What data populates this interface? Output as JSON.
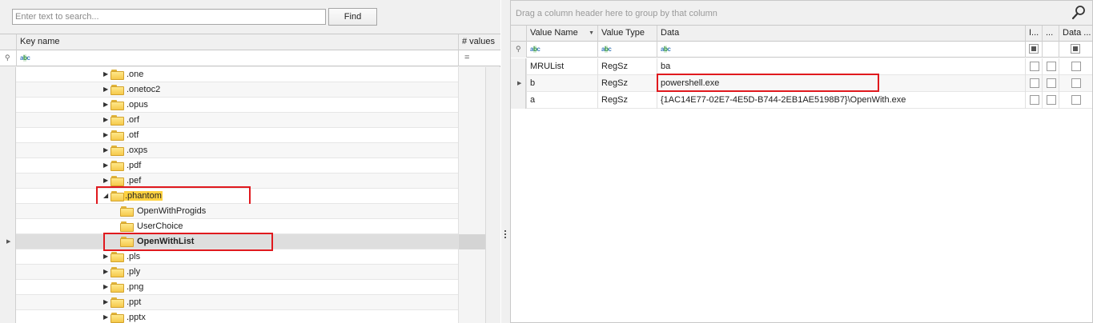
{
  "search": {
    "placeholder": "Enter text to search...",
    "find_label": "Find"
  },
  "tree": {
    "columns": {
      "key_name": "Key name",
      "values": "# values"
    },
    "rows": [
      {
        "label": ".one",
        "level": 1,
        "expander": "▶"
      },
      {
        "label": ".onetoc2",
        "level": 1,
        "expander": "▶"
      },
      {
        "label": ".opus",
        "level": 1,
        "expander": "▶"
      },
      {
        "label": ".orf",
        "level": 1,
        "expander": "▶"
      },
      {
        "label": ".otf",
        "level": 1,
        "expander": "▶"
      },
      {
        "label": ".oxps",
        "level": 1,
        "expander": "▶"
      },
      {
        "label": ".pdf",
        "level": 1,
        "expander": "▶"
      },
      {
        "label": ".pef",
        "level": 1,
        "expander": "▶"
      },
      {
        "label": ".phantom",
        "level": 1,
        "expander": "◢",
        "highlight": true,
        "boxed": true
      },
      {
        "label": "OpenWithProgids",
        "level": 2,
        "expander": ""
      },
      {
        "label": "UserChoice",
        "level": 2,
        "expander": ""
      },
      {
        "label": "OpenWithList",
        "level": 2,
        "expander": "",
        "selected": true,
        "bold": true,
        "boxed": true
      },
      {
        "label": ".pls",
        "level": 1,
        "expander": "▶"
      },
      {
        "label": ".ply",
        "level": 1,
        "expander": "▶"
      },
      {
        "label": ".png",
        "level": 1,
        "expander": "▶"
      },
      {
        "label": ".ppt",
        "level": 1,
        "expander": "▶"
      },
      {
        "label": ".pptx",
        "level": 1,
        "expander": "▶"
      }
    ]
  },
  "values_grid": {
    "group_hint": "Drag a column header here to group by that column",
    "columns": {
      "value_name": "Value Name",
      "value_type": "Value Type",
      "data": "Data",
      "is_deleted": "I...",
      "dots": "...",
      "data_mismatch": "Data ..."
    },
    "rows": [
      {
        "name": "MRUList",
        "type": "RegSz",
        "data": "ba"
      },
      {
        "name": "b",
        "type": "RegSz",
        "data": "powershell.exe",
        "boxed": true,
        "current": true
      },
      {
        "name": "a",
        "type": "RegSz",
        "data": "{1AC14E77-02E7-4E5D-B744-2EB1AE5198B7}\\OpenWith.exe"
      }
    ]
  },
  "colors": {
    "highlight_box": "#e0191e",
    "text_highlight": "#ffd23f",
    "folder": "#f5c94b"
  }
}
